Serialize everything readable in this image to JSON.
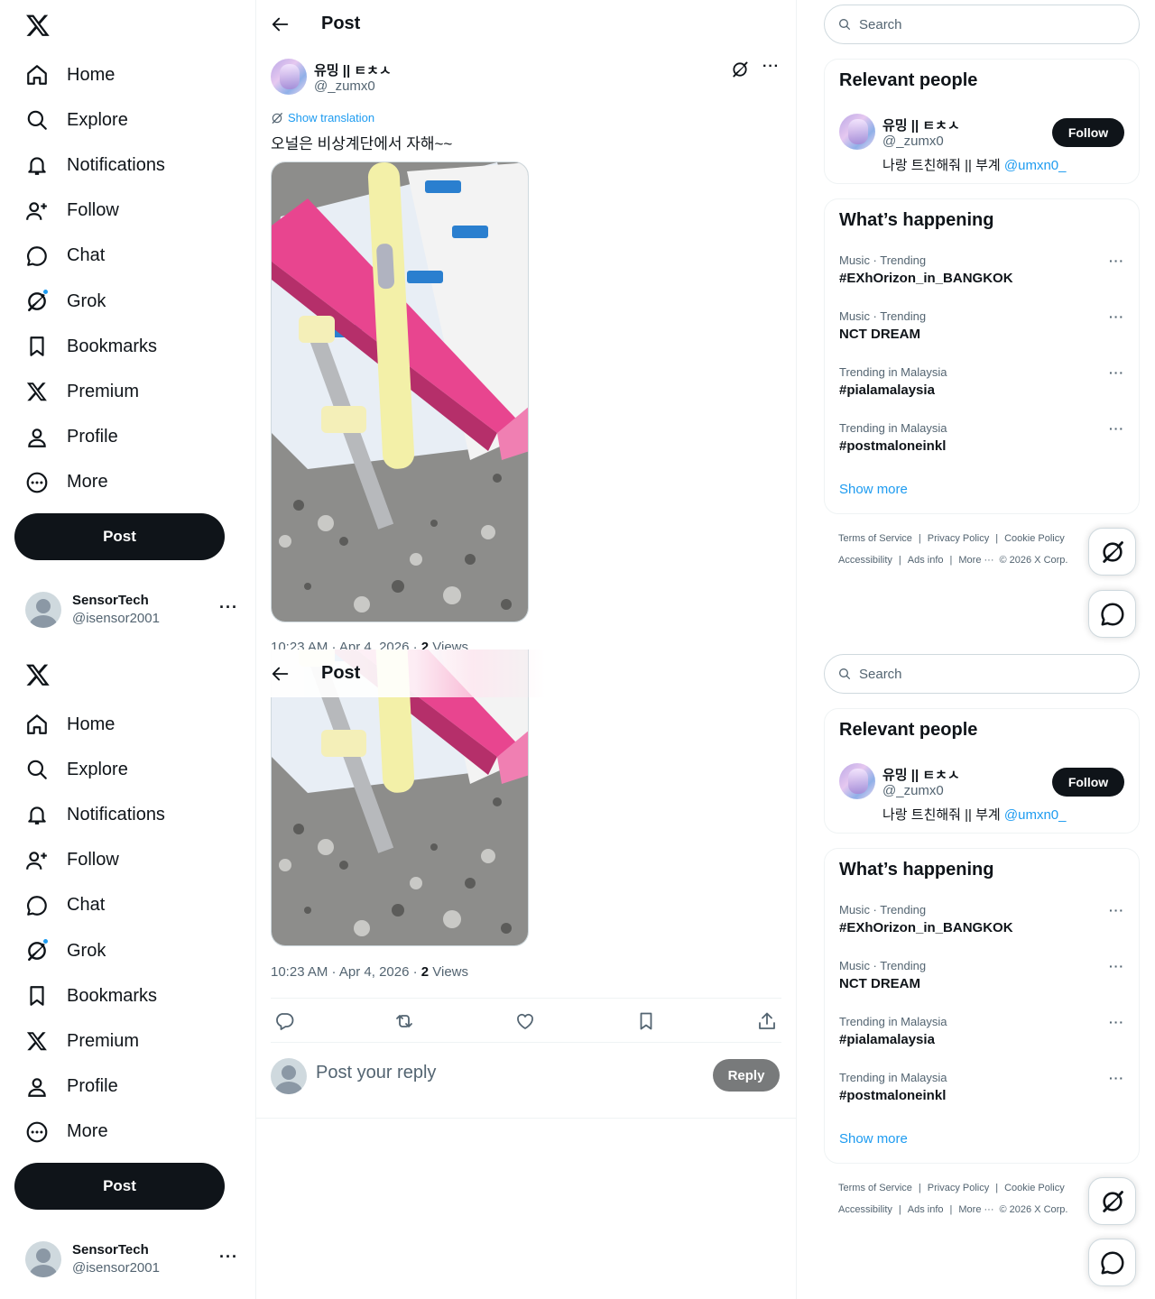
{
  "nav": {
    "items": [
      {
        "label": "Home",
        "icon": "home-icon"
      },
      {
        "label": "Explore",
        "icon": "search-icon"
      },
      {
        "label": "Notifications",
        "icon": "bell-icon"
      },
      {
        "label": "Follow",
        "icon": "follow-icon"
      },
      {
        "label": "Chat",
        "icon": "chat-icon"
      },
      {
        "label": "Grok",
        "icon": "grok-icon"
      },
      {
        "label": "Bookmarks",
        "icon": "bookmark-icon"
      },
      {
        "label": "Premium",
        "icon": "x-icon"
      },
      {
        "label": "Profile",
        "icon": "profile-icon"
      },
      {
        "label": "More",
        "icon": "more-circle-icon"
      }
    ],
    "post_label": "Post",
    "account": {
      "name": "SensorTech",
      "handle": "@isensor2001",
      "more": "···"
    }
  },
  "main": {
    "header_title": "Post",
    "author": {
      "name": "유밍 || ㅌㅊㅅ",
      "handle": "@_zumx0",
      "more": "···"
    },
    "show_translation": "Show translation",
    "text": "오널은 비상계단에서 자해~~",
    "meta": {
      "time": "10:23 AM · Apr 4, 2026 · ",
      "views_count": "2",
      "views_label": " Views"
    },
    "reply_placeholder": "Post your reply",
    "reply_label": "Reply"
  },
  "right": {
    "search_placeholder": "Search",
    "relevant_title": "Relevant people",
    "person": {
      "name": "유밍 || ㅌㅊㅅ",
      "handle": "@_zumx0",
      "bio": "나랑 트친해줘 || 부계 ",
      "bio_link": "@umxn0_",
      "follow_label": "Follow"
    },
    "happening_title": "What’s happening",
    "trends": [
      {
        "context": "Music · Trending",
        "title": "#EXhOrizon_in_BANGKOK"
      },
      {
        "context": "Music · Trending",
        "title": "NCT DREAM"
      },
      {
        "context": "Trending in Malaysia",
        "title": "#pialamalaysia"
      },
      {
        "context": "Trending in Malaysia",
        "title": "#postmaloneinkl"
      }
    ],
    "trend_more": "···",
    "show_more": "Show more",
    "footer": {
      "terms": "Terms of Service",
      "privacy": "Privacy Policy",
      "cookie": "Cookie Policy",
      "accessibility": "Accessibility",
      "ads": "Ads info",
      "more": "More ···",
      "copyright": "© 2026 X Corp."
    }
  },
  "colors": {
    "accent": "#1d9bf0",
    "text": "#0f1419",
    "muted": "#536471",
    "button_dark": "#0f1419",
    "reply_disabled": "#787a7b"
  }
}
